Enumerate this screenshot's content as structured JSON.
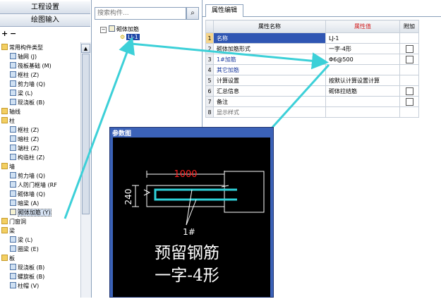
{
  "nav": {
    "project_settings": "工程设置",
    "drawing_input": "绘图输入"
  },
  "left_tree": [
    {
      "label": "常用构件类型",
      "kind": "folder"
    },
    {
      "label": "轴网 (J)",
      "kind": "el"
    },
    {
      "label": "筏板基础 (M)",
      "kind": "el"
    },
    {
      "label": "框柱 (Z)",
      "kind": "el"
    },
    {
      "label": "剪力墙 (Q)",
      "kind": "el"
    },
    {
      "label": "梁 (L)",
      "kind": "el"
    },
    {
      "label": "现浇板 (B)",
      "kind": "el"
    },
    {
      "label": "轴线",
      "kind": "folder"
    },
    {
      "label": "柱",
      "kind": "folder"
    },
    {
      "label": "框柱 (Z)",
      "kind": "el"
    },
    {
      "label": "暗柱 (Z)",
      "kind": "el"
    },
    {
      "label": "端柱 (Z)",
      "kind": "el"
    },
    {
      "label": "构造柱 (Z)",
      "kind": "el"
    },
    {
      "label": "墙",
      "kind": "folder"
    },
    {
      "label": "剪力墙 (Q)",
      "kind": "el"
    },
    {
      "label": "人防门框墙 (RF",
      "kind": "el"
    },
    {
      "label": "砌体墙 (Q)",
      "kind": "el"
    },
    {
      "label": "暗梁 (A)",
      "kind": "el"
    },
    {
      "label": "砌体加筋 (Y)",
      "kind": "sel"
    },
    {
      "label": "门窗洞",
      "kind": "folder"
    },
    {
      "label": "梁",
      "kind": "folder"
    },
    {
      "label": "梁 (L)",
      "kind": "el"
    },
    {
      "label": "圈梁 (E)",
      "kind": "el"
    },
    {
      "label": "板",
      "kind": "folder"
    },
    {
      "label": "现浇板 (B)",
      "kind": "el"
    },
    {
      "label": "螺旋板 (B)",
      "kind": "el"
    },
    {
      "label": "柱帽 (V)",
      "kind": "el"
    }
  ],
  "search": {
    "placeholder": "搜索构件..."
  },
  "component_tree": {
    "root": "砌体加筋",
    "child": "LJ-1"
  },
  "properties": {
    "tab_label": "属性编辑",
    "headers": [
      "属性名称",
      "属性值",
      "附加"
    ],
    "rows": [
      {
        "num": "1",
        "name": "名称",
        "value": "LJ-1",
        "check": false,
        "name_blue": true
      },
      {
        "num": "2",
        "name": "砌体加筋形式",
        "value": "一字-4形",
        "check": true,
        "name_blue": false
      },
      {
        "num": "3",
        "name": "1#加筋",
        "value": "Φ6@500",
        "check": true,
        "name_blue": true
      },
      {
        "num": "4",
        "name": "其它加筋",
        "value": "",
        "check": false,
        "name_blue": true
      },
      {
        "num": "5",
        "name": "计算设置",
        "value": "按默认计算设置计算",
        "check": false,
        "name_blue": false
      },
      {
        "num": "6",
        "name": "汇总信息",
        "value": "砌体拉结筋",
        "check": true,
        "name_blue": false
      },
      {
        "num": "7",
        "name": "备注",
        "value": "",
        "check": true,
        "name_blue": false
      },
      {
        "num": "8",
        "name": "显示样式",
        "value": "",
        "check": false,
        "name_blue": false
      }
    ]
  },
  "dialog": {
    "title": "参数图",
    "dim_length": "1000",
    "dim_height": "240",
    "bar_label": "1#",
    "caption_line1": "预留钢筋",
    "caption_line2": "一字-4形"
  },
  "colors": {
    "arrow": "#3cd0d8",
    "bar": "#2fd0d8",
    "header_value": "#d22020",
    "link_text": "#1a3a9e",
    "dialog_frame": "#3b62b8"
  }
}
